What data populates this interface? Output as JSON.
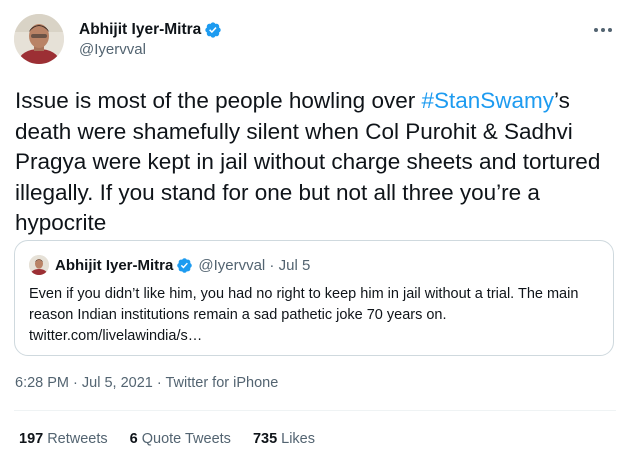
{
  "author": {
    "name": "Abhijit Iyer-Mitra",
    "handle": "@Iyervval"
  },
  "tweet": {
    "text_before": "Issue is most of the people howling over ",
    "hashtag": "#StanSwamy",
    "text_after": "’s death were shamefully silent when Col Purohit & Sadhvi Pragya were kept in jail without charge sheets and tortured illegally. If you stand for one but not all three you’re a hypocrite"
  },
  "quote": {
    "name": "Abhijit Iyer-Mitra",
    "handle_date": "@Iyervval · Jul 5",
    "text": "Even if you didn’t like him, you had no right to keep him in jail without a trial. The main reason Indian institutions remain a sad pathetic joke 70 years on. twitter.com/livelawindia/s…"
  },
  "meta": {
    "timestamp": "6:28 PM · Jul 5, 2021 · Twitter for iPhone"
  },
  "stats": {
    "retweets_count": "197",
    "retweets_label": "Retweets",
    "quotes_count": "6",
    "quotes_label": "Quote Tweets",
    "likes_count": "735",
    "likes_label": "Likes"
  },
  "icons": {
    "verified": "verified-badge-icon",
    "more": "more-horizontal-icon"
  },
  "colors": {
    "accent": "#1d9bf0",
    "text": "#0f1419",
    "secondary": "#536471",
    "border": "#cfd9de"
  }
}
